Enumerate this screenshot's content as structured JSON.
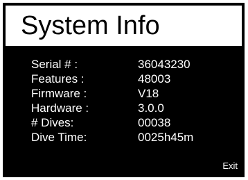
{
  "screen": {
    "title": "System Info",
    "rows": [
      {
        "label": "Serial #   :",
        "value": "36043230"
      },
      {
        "label": "Features  :",
        "value": "48003"
      },
      {
        "label": "Firmware :",
        "value": "V18"
      },
      {
        "label": "Hardware :",
        "value": "3.0.0"
      },
      {
        "label": "# Dives:",
        "value": "00038"
      },
      {
        "label": "Dive Time:",
        "value": "0025h45m"
      }
    ],
    "exit_label": "Exit"
  },
  "colors": {
    "background": "#000000",
    "title_bar": "#ffffff",
    "text": "#ffffff",
    "title_text": "#000000"
  }
}
